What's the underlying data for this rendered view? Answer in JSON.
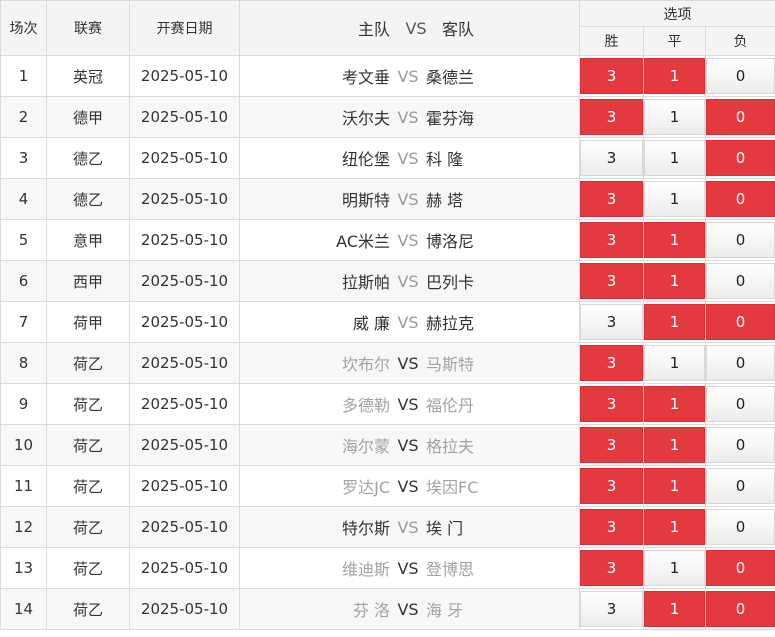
{
  "header": {
    "col_index": "场次",
    "col_league": "联赛",
    "col_date": "开赛日期",
    "col_home": "主队",
    "col_vs": "VS",
    "col_away": "客队",
    "col_options": "选项",
    "opt_win": "胜",
    "opt_draw": "平",
    "opt_lose": "负"
  },
  "colors": {
    "selected": "#e23a3f",
    "muted_text": "#a3a3a3"
  },
  "matches": [
    {
      "index": "1",
      "league": "英冠",
      "date": "2025-05-10",
      "home": "考文垂",
      "vs": "VS",
      "away": "桑德兰",
      "muted": false,
      "win": "3",
      "draw": "1",
      "lose": "0",
      "sel": [
        true,
        true,
        false
      ]
    },
    {
      "index": "2",
      "league": "德甲",
      "date": "2025-05-10",
      "home": "沃尔夫",
      "vs": "VS",
      "away": "霍芬海",
      "muted": false,
      "win": "3",
      "draw": "1",
      "lose": "0",
      "sel": [
        true,
        false,
        true
      ]
    },
    {
      "index": "3",
      "league": "德乙",
      "date": "2025-05-10",
      "home": "纽伦堡",
      "vs": "VS",
      "away": "科 隆",
      "muted": false,
      "win": "3",
      "draw": "1",
      "lose": "0",
      "sel": [
        false,
        false,
        true
      ]
    },
    {
      "index": "4",
      "league": "德乙",
      "date": "2025-05-10",
      "home": "明斯特",
      "vs": "VS",
      "away": "赫 塔",
      "muted": false,
      "win": "3",
      "draw": "1",
      "lose": "0",
      "sel": [
        true,
        false,
        true
      ]
    },
    {
      "index": "5",
      "league": "意甲",
      "date": "2025-05-10",
      "home": "AC米兰",
      "vs": "VS",
      "away": "博洛尼",
      "muted": false,
      "win": "3",
      "draw": "1",
      "lose": "0",
      "sel": [
        true,
        true,
        false
      ]
    },
    {
      "index": "6",
      "league": "西甲",
      "date": "2025-05-10",
      "home": "拉斯帕",
      "vs": "VS",
      "away": "巴列卡",
      "muted": false,
      "win": "3",
      "draw": "1",
      "lose": "0",
      "sel": [
        true,
        true,
        false
      ]
    },
    {
      "index": "7",
      "league": "荷甲",
      "date": "2025-05-10",
      "home": "威 廉",
      "vs": "VS",
      "away": "赫拉克",
      "muted": false,
      "win": "3",
      "draw": "1",
      "lose": "0",
      "sel": [
        false,
        true,
        true
      ]
    },
    {
      "index": "8",
      "league": "荷乙",
      "date": "2025-05-10",
      "home": "坎布尔",
      "vs": "VS",
      "away": "马斯特",
      "muted": true,
      "win": "3",
      "draw": "1",
      "lose": "0",
      "sel": [
        true,
        false,
        false
      ]
    },
    {
      "index": "9",
      "league": "荷乙",
      "date": "2025-05-10",
      "home": "多德勒",
      "vs": "VS",
      "away": "福伦丹",
      "muted": true,
      "win": "3",
      "draw": "1",
      "lose": "0",
      "sel": [
        true,
        true,
        false
      ]
    },
    {
      "index": "10",
      "league": "荷乙",
      "date": "2025-05-10",
      "home": "海尔蒙",
      "vs": "VS",
      "away": "格拉夫",
      "muted": true,
      "win": "3",
      "draw": "1",
      "lose": "0",
      "sel": [
        true,
        true,
        false
      ]
    },
    {
      "index": "11",
      "league": "荷乙",
      "date": "2025-05-10",
      "home": "罗达JC",
      "vs": "VS",
      "away": "埃因FC",
      "muted": true,
      "win": "3",
      "draw": "1",
      "lose": "0",
      "sel": [
        true,
        true,
        false
      ]
    },
    {
      "index": "12",
      "league": "荷乙",
      "date": "2025-05-10",
      "home": "特尔斯",
      "vs": "VS",
      "away": "埃 门",
      "muted": false,
      "win": "3",
      "draw": "1",
      "lose": "0",
      "sel": [
        true,
        true,
        false
      ]
    },
    {
      "index": "13",
      "league": "荷乙",
      "date": "2025-05-10",
      "home": "维迪斯",
      "vs": "VS",
      "away": "登博思",
      "muted": true,
      "win": "3",
      "draw": "1",
      "lose": "0",
      "sel": [
        true,
        false,
        true
      ]
    },
    {
      "index": "14",
      "league": "荷乙",
      "date": "2025-05-10",
      "home": "芬 洛",
      "vs": "VS",
      "away": "海 牙",
      "muted": true,
      "win": "3",
      "draw": "1",
      "lose": "0",
      "sel": [
        false,
        true,
        true
      ]
    }
  ]
}
